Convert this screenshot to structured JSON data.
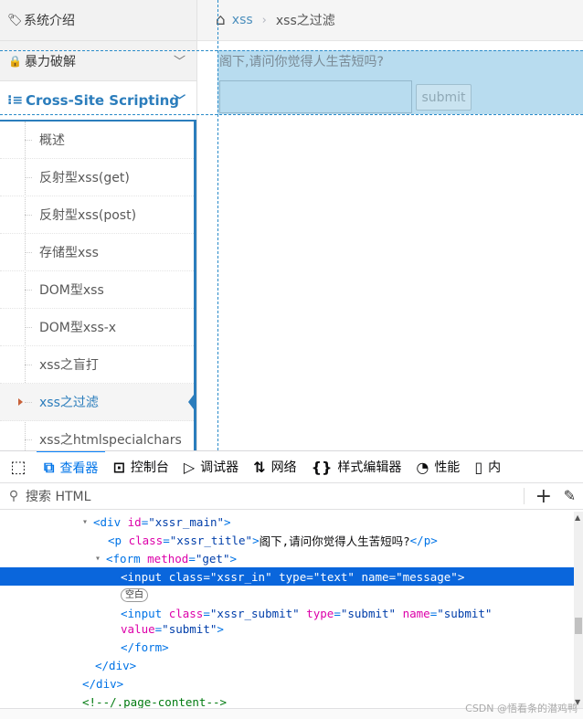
{
  "sidebar": {
    "system_intro": "系统介绍",
    "brute_force": "暴力破解",
    "xss_section": "Cross-Site Scripting",
    "items": [
      "概述",
      "反射型xss(get)",
      "反射型xss(post)",
      "存储型xss",
      "DOM型xss",
      "DOM型xss-x",
      "xss之盲打",
      "xss之过滤",
      "xss之htmlspecialchars"
    ],
    "active_index": 7
  },
  "breadcrumb": {
    "link": "xss",
    "current": "xss之过滤",
    "sep": "›"
  },
  "main": {
    "title": "阁下,请问你觉得人生苦短吗?",
    "input_value": "",
    "submit_label": "submit"
  },
  "devtools": {
    "tabs": [
      {
        "icon": "⧉",
        "label": "查看器"
      },
      {
        "icon": "⊡",
        "label": "控制台"
      },
      {
        "icon": "▷",
        "label": "调试器"
      },
      {
        "icon": "⇅",
        "label": "网络"
      },
      {
        "icon": "{}",
        "label": "样式编辑器"
      },
      {
        "icon": "◔",
        "label": "性能"
      },
      {
        "icon": "▯",
        "label": "内"
      }
    ],
    "selected_tab": 0,
    "search_placeholder": "搜索 HTML",
    "badge": "空白"
  },
  "watermark": "CSDN @悟看条的潜鸡鸭",
  "colors": {
    "accent": "#2b7dbc",
    "highlight": "#b8dcef",
    "selection": "#0a66dc"
  }
}
